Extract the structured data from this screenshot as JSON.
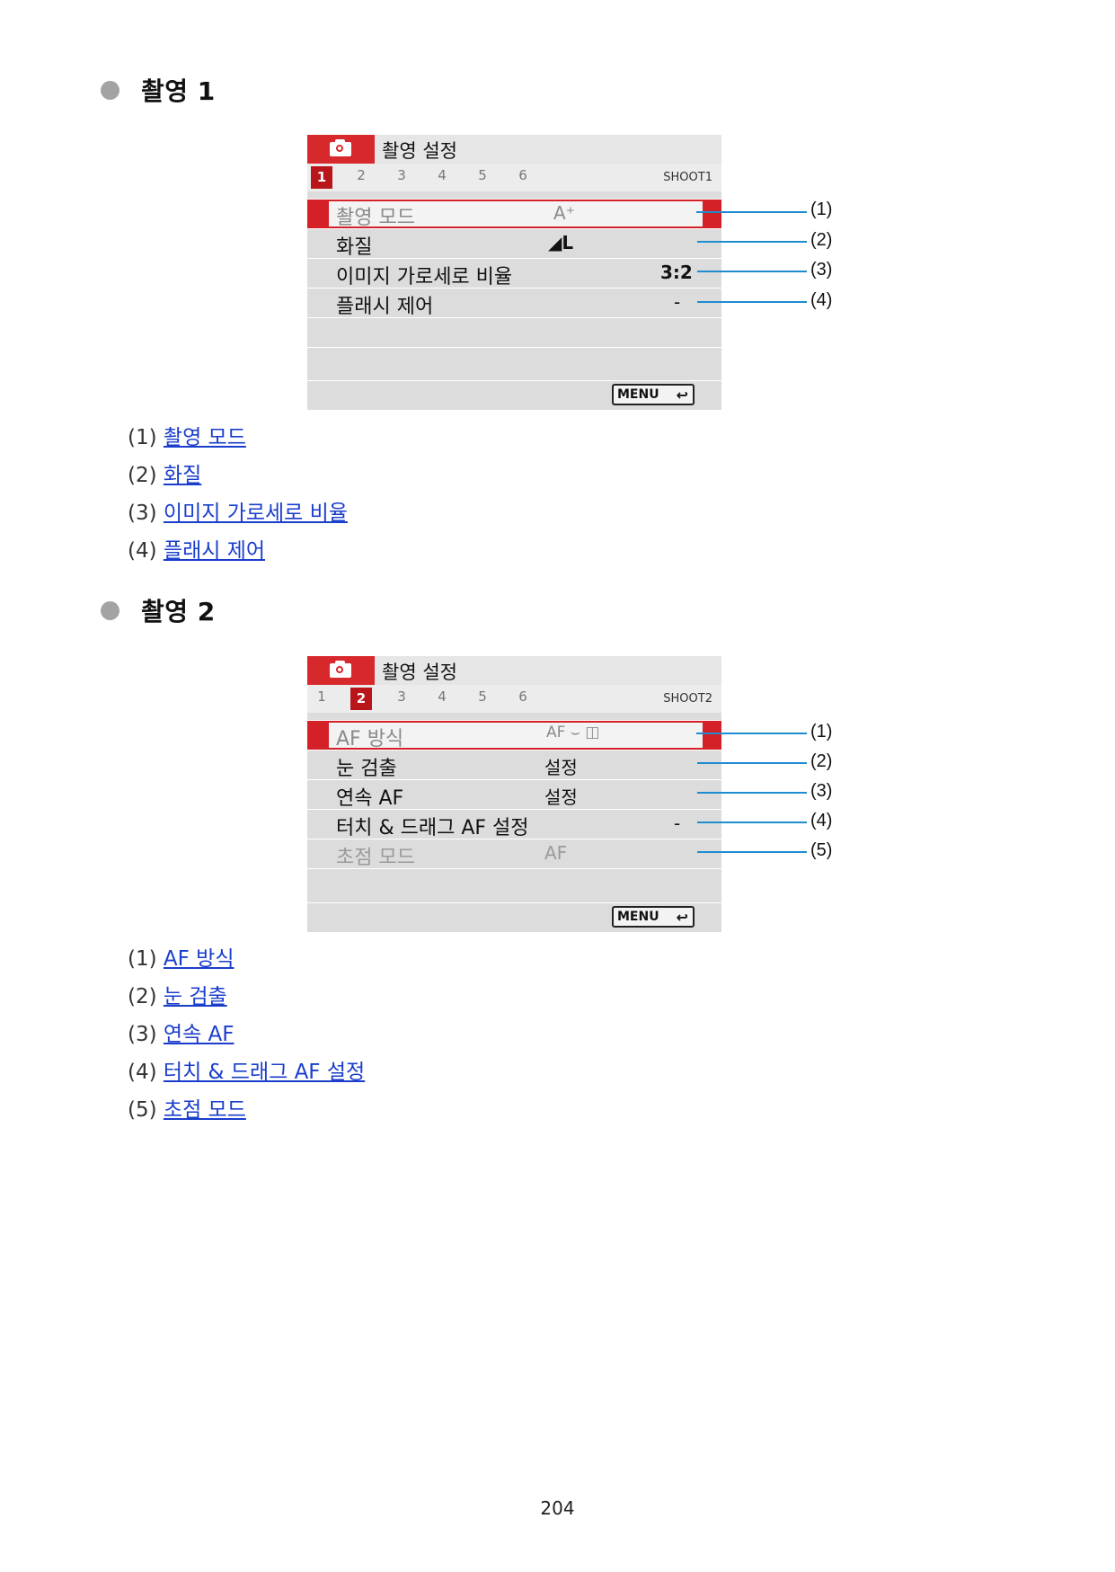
{
  "sections": [
    {
      "heading": "촬영 1",
      "screen": {
        "title": "촬영 설정",
        "tabs": [
          "1",
          "2",
          "3",
          "4",
          "5",
          "6"
        ],
        "active_tab": "1",
        "shoot_label": "SHOOT1",
        "rows": [
          {
            "label": "촬영 모드",
            "value": "A⁺",
            "selected": true,
            "dim": false
          },
          {
            "label": "화질",
            "value": "◢L",
            "selected": false,
            "dim": false
          },
          {
            "label": "이미지 가로세로 비율",
            "value": "3:2",
            "selected": false,
            "dim": false
          },
          {
            "label": "플래시 제어",
            "value": "-",
            "selected": false,
            "dim": false
          },
          {
            "label": "",
            "value": "",
            "selected": false,
            "dim": false
          },
          {
            "label": "",
            "value": "",
            "selected": false,
            "dim": false
          }
        ],
        "menu_button": "MENU",
        "return_icon": "↩"
      },
      "callouts": [
        "(1)",
        "(2)",
        "(3)",
        "(4)"
      ],
      "list": [
        {
          "num": "(1)",
          "link": "촬영 모드"
        },
        {
          "num": "(2)",
          "link": "화질"
        },
        {
          "num": "(3)",
          "link": "이미지 가로세로 비율"
        },
        {
          "num": "(4)",
          "link": "플래시 제어"
        }
      ]
    },
    {
      "heading": "촬영 2",
      "screen": {
        "title": "촬영 설정",
        "tabs": [
          "1",
          "2",
          "3",
          "4",
          "5",
          "6"
        ],
        "active_tab": "2",
        "shoot_label": "SHOOT2",
        "rows": [
          {
            "label": "AF 방식",
            "value": "AF ⌣ ◫",
            "selected": true,
            "dim": false
          },
          {
            "label": "눈 검출",
            "value": "설정",
            "selected": false,
            "dim": false
          },
          {
            "label": "연속 AF",
            "value": "설정",
            "selected": false,
            "dim": false
          },
          {
            "label": "터치 & 드래그 AF 설정",
            "value": "-",
            "selected": false,
            "dim": false
          },
          {
            "label": "초점 모드",
            "value": "AF",
            "selected": false,
            "dim": true
          },
          {
            "label": "",
            "value": "",
            "selected": false,
            "dim": false
          }
        ],
        "menu_button": "MENU",
        "return_icon": "↩"
      },
      "callouts": [
        "(1)",
        "(2)",
        "(3)",
        "(4)",
        "(5)"
      ],
      "list": [
        {
          "num": "(1)",
          "link": "AF 방식"
        },
        {
          "num": "(2)",
          "link": "눈 검출"
        },
        {
          "num": "(3)",
          "link": "연속 AF"
        },
        {
          "num": "(4)",
          "link": "터치 & 드래그 AF 설정"
        },
        {
          "num": "(5)",
          "link": "초점 모드"
        }
      ]
    }
  ],
  "page_number": "204",
  "colors": {
    "accent_red": "#d42027",
    "link_blue": "#1a3dcc",
    "callout_line": "#1f8cd0"
  }
}
